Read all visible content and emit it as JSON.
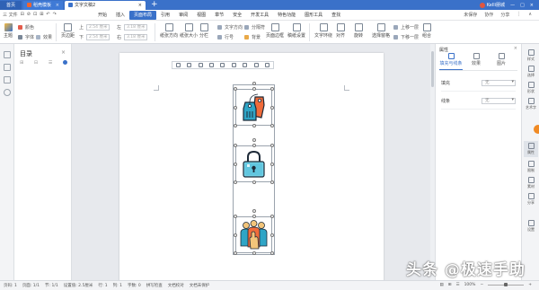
{
  "titlebar": {
    "tabs": [
      {
        "label": "首页"
      },
      {
        "label": "稻壳模板"
      },
      {
        "label": "文字文稿2"
      }
    ],
    "new_tab": "+",
    "user_name": "Kelli朋城",
    "win_controls": [
      "—",
      "□",
      "×"
    ]
  },
  "menubar": {
    "file": "三 文件",
    "quick": [
      "⊟",
      "⊘",
      "⊡",
      "⊞",
      "↶",
      "↷"
    ],
    "items": [
      "开始",
      "插入",
      "页面布局",
      "引用",
      "审阅",
      "视图",
      "章节",
      "安全",
      "开发工具",
      "特色功能",
      "图形工具",
      "查找"
    ],
    "active_index": 2,
    "right": [
      "未保存",
      "协作",
      "分享",
      "⋮",
      "∧"
    ]
  },
  "ribbon": {
    "left": {
      "theme": "主题",
      "colors": "颜色",
      "fonts": "字体",
      "effects": "效果"
    },
    "margins": {
      "label": "页边距"
    },
    "page_fields": [
      {
        "label": "上",
        "value": "2.54 厘米"
      },
      {
        "label": "下",
        "value": "2.54 厘米"
      },
      {
        "label": "左",
        "value": "3.18 厘米"
      },
      {
        "label": "右",
        "value": "3.18 厘米"
      }
    ],
    "orientation": "纸张方向",
    "size": "纸张大小",
    "columns": "分栏",
    "text_direction": "文字方向",
    "line_numbers": "行号",
    "separator": "分隔符",
    "background": "背景",
    "page_border": "页面边框",
    "manuscript": "稿纸设置",
    "wrap": "文字环绕",
    "align": "对齐",
    "rotate": "旋转",
    "select_pane": "选择窗格",
    "bring_forward": "上移一层",
    "send_backward": "下移一层",
    "group": "组合"
  },
  "toc": {
    "title": "目录",
    "close": "×",
    "tools": [
      "⊞",
      "⊟",
      "☰"
    ]
  },
  "props": {
    "title": "属性",
    "close": "×",
    "tabs": [
      "填充与线条",
      "效果",
      "图片"
    ],
    "rows": [
      {
        "label": "填充",
        "value": "无"
      },
      {
        "label": "线条",
        "value": "无"
      }
    ]
  },
  "rstrip": {
    "items": [
      "样式",
      "选择",
      "形状",
      "艺术字",
      "属性",
      "限制",
      "素材",
      "分享",
      "设置"
    ]
  },
  "status": {
    "left": [
      "页码: 1",
      "页面: 1/1",
      "节: 1/1",
      "设置值: 2.5厘米",
      "行: 1",
      "列: 1",
      "字数: 0",
      "拼写检查",
      "文档校对",
      "文档未保护"
    ],
    "zoom": "100%",
    "zoom_value": 0.5
  },
  "watermark": "头条 @极速手助",
  "colors": {
    "accent": "#3a71c9",
    "tag_orange": "#f06b3a",
    "teal": "#36a9c9"
  }
}
